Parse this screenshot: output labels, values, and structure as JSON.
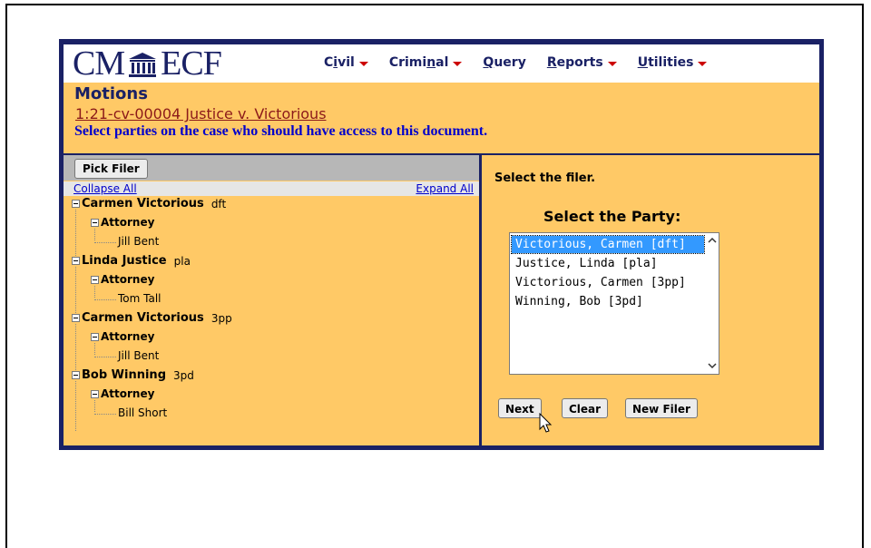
{
  "header": {
    "logo_left": "CM",
    "logo_right": "ECF",
    "menu": [
      {
        "pre": "C",
        "u": "i",
        "post": "vil",
        "caret": true
      },
      {
        "pre": "Crimi",
        "u": "n",
        "post": "al",
        "caret": true
      },
      {
        "pre": "",
        "u": "Q",
        "post": "uery",
        "caret": false
      },
      {
        "pre": "",
        "u": "R",
        "post": "eports",
        "caret": true
      },
      {
        "pre": "",
        "u": "U",
        "post": "tilities",
        "caret": true
      }
    ]
  },
  "page": {
    "title": "Motions",
    "case_link": "1:21-cv-00004 Justice v. Victorious",
    "instruction": "Select parties on the case who should have access to this document."
  },
  "left": {
    "pick_filer": "Pick Filer",
    "collapse_all": "Collapse All",
    "expand_all": "Expand All",
    "tree": [
      {
        "name": "Carmen Victorious",
        "role": "dft",
        "group": "Attorney",
        "attorney": "Jill Bent"
      },
      {
        "name": "Linda Justice",
        "role": "pla",
        "group": "Attorney",
        "attorney": "Tom Tall"
      },
      {
        "name": "Carmen Victorious",
        "role": "3pp",
        "group": "Attorney",
        "attorney": "Jill Bent"
      },
      {
        "name": "Bob Winning",
        "role": "3pd",
        "group": "Attorney",
        "attorney": "Bill Short"
      }
    ]
  },
  "right": {
    "prompt": "Select the filer.",
    "heading": "Select the Party:",
    "options": [
      "Victorious, Carmen [dft]",
      "Justice, Linda [pla]",
      "Victorious, Carmen [3pp]",
      "Winning, Bob [3pd]"
    ],
    "selected_index": 0,
    "buttons": {
      "next": "Next",
      "clear": "Clear",
      "new_filer": "New Filer"
    }
  },
  "colors": {
    "navy": "#1a2165",
    "panel": "#ffc966",
    "link": "#8b1a1a",
    "instruction": "#0000cc",
    "selection": "#3399ff"
  }
}
